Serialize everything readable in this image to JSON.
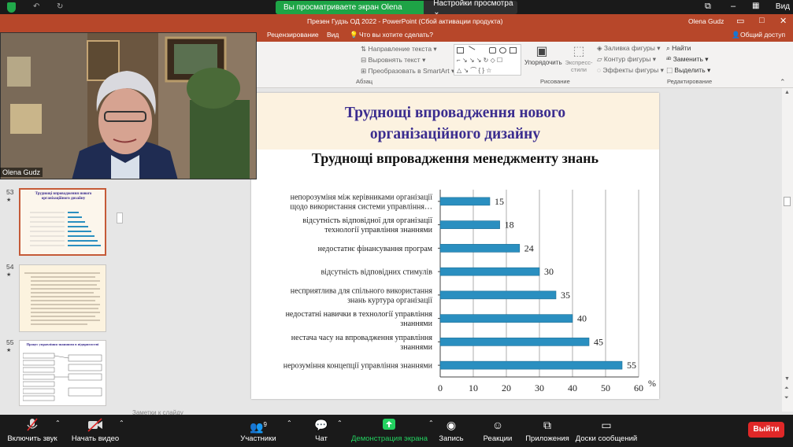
{
  "zoom_top": {
    "share_banner": "Вы просматриваете экран Olena Gudz",
    "view_options": "Настройки просмотра ⌄",
    "view_button": "Вид"
  },
  "ppt": {
    "window_title": "Презен Гудзь ОД 2022 - PowerPoint (Сбой активации продукта)",
    "user_name": "Olena Gudz",
    "share_label": "Общий доступ",
    "tabs": [
      "Рецензирование",
      "Вид",
      "Что вы хотите сделать?"
    ],
    "ribbon": {
      "text_direction": "Направление текста",
      "align_text": "Выровнять текст",
      "smartart": "Преобразовать в SmartArt",
      "paragraph_group": "Абзац",
      "arrange": "Упорядочить",
      "quick_styles": "Экспресс-стили",
      "shape_fill": "Заливка фигуры",
      "shape_outline": "Контур фигуры",
      "shape_effects": "Эффекты фигуры",
      "drawing_group": "Рисование",
      "find": "Найти",
      "replace": "Заменить",
      "select": "Выделить",
      "editing_group": "Редактирование"
    },
    "thumbnails": [
      {
        "num": "53",
        "title": "Труднощі впровадження нового організаційного дизайну"
      },
      {
        "num": "54",
        "title": ""
      },
      {
        "num": "55",
        "title": "Процес управління знаннями в підприємстві"
      }
    ],
    "notes_placeholder": "Заметки к слайду"
  },
  "slide": {
    "title_line1": "Труднощі впровадження нового",
    "title_line2": "організаційного дизайну",
    "subtitle": "Труднощі впровадження менеджменту знань"
  },
  "chart_data": {
    "type": "bar",
    "orientation": "horizontal",
    "categories": [
      [
        "непорозуміня між керівниками організації",
        "щодо використання системи управління…"
      ],
      [
        "відсутність відповідної для організації",
        "технології управління знаннями"
      ],
      [
        "недостатнє фінансування програм"
      ],
      [
        "відсутність відповідних стимулів"
      ],
      [
        "несприятлива для спільного використання",
        "знань куртура організації"
      ],
      [
        "недостатні навички в технології управління",
        "знаннями"
      ],
      [
        "нестача часу на впровадження управління",
        "знаннями"
      ],
      [
        "нерозуміння концепції управління знаннями"
      ]
    ],
    "values": [
      15,
      18,
      24,
      30,
      35,
      40,
      45,
      55
    ],
    "xlim": [
      0,
      60
    ],
    "xticks": [
      0,
      10,
      20,
      30,
      40,
      50,
      60
    ],
    "unit_label": "%",
    "bar_color": "#2a8fc0",
    "grid": true
  },
  "cam": {
    "participant_name": "Olena Gudz"
  },
  "zoom_bottom": {
    "mute": "Включить звук",
    "video": "Начать видео",
    "participants": "Участники",
    "participants_count": "9",
    "chat": "Чат",
    "share_screen": "Демонстрация экрана",
    "record": "Запись",
    "reactions": "Реакции",
    "apps": "Приложения",
    "whiteboards": "Доски сообщений",
    "leave": "Выйти"
  }
}
